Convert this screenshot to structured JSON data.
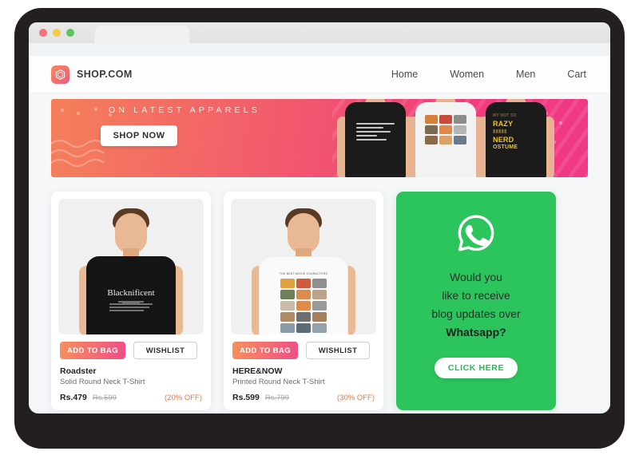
{
  "window": {
    "traffic_lights": [
      {
        "name": "close",
        "color": "#f4717f"
      },
      {
        "name": "minimize",
        "color": "#f3ca4b"
      },
      {
        "name": "maximize",
        "color": "#5cc35c"
      }
    ],
    "tab_title": ""
  },
  "header": {
    "logo_icon": "hexagon-logo-icon",
    "brand": "SHOP.COM",
    "nav": [
      {
        "label": "Home"
      },
      {
        "label": "Women"
      },
      {
        "label": "Men"
      },
      {
        "label": "Cart"
      }
    ]
  },
  "hero": {
    "tagline": "ON LATEST APPARELS",
    "cta_label": "SHOP NOW",
    "gradient_from": "#f4805a",
    "gradient_to": "#ee3a85",
    "models": [
      {
        "tee": "black",
        "print": "definition-text"
      },
      {
        "tee": "white",
        "print": "character-grid"
      },
      {
        "tee": "black",
        "print": "CRAZY NERD COSTUME"
      }
    ],
    "nerd_print": {
      "line1": "MY NOT SO",
      "line2": "RAZY",
      "line3": "NERD",
      "line4": "OSTUME"
    }
  },
  "products": [
    {
      "image_alt": "man-in-black-blacknificent-tshirt",
      "tee_print_title": "Blacknificent",
      "add_label": "ADD TO BAG",
      "wishlist_label": "WISHLIST",
      "brand": "Roadster",
      "description": "Solid Round Neck T-Shirt",
      "price_now": "Rs.479",
      "price_was": "Rs.599",
      "discount": "(20% OFF)"
    },
    {
      "image_alt": "man-in-white-printed-tshirt",
      "tee_print_title": "THE BEST MOVIE CHARACTERS",
      "add_label": "ADD TO BAG",
      "wishlist_label": "WISHLIST",
      "brand": "HERE&NOW",
      "description": "Printed Round Neck T-Shirt",
      "price_now": "Rs.599",
      "price_was": "Rs.799",
      "discount": "(30% OFF)"
    }
  ],
  "whatsapp": {
    "icon": "whatsapp-icon",
    "line1": "Would you",
    "line2": "like to receive",
    "line3": "blog updates over",
    "line4": "Whatsapp?",
    "cta_label": "CLICK HERE",
    "background": "#2cc45c",
    "cta_text_color": "#2cb757"
  }
}
